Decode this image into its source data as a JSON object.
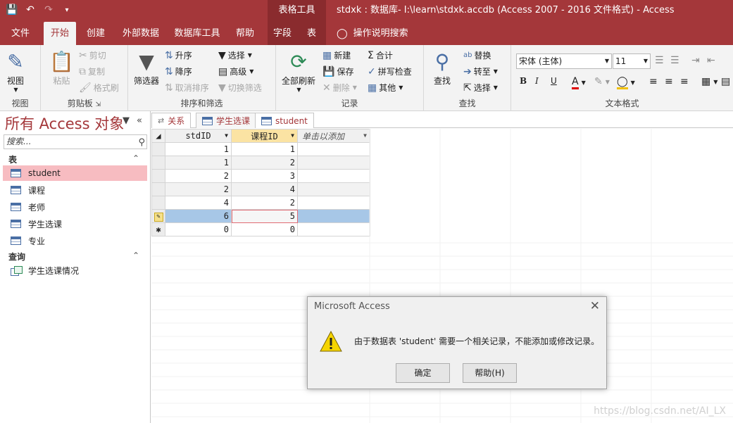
{
  "window": {
    "title": "stdxk : 数据库- I:\\learn\\stdxk.accdb (Access 2007 - 2016 文件格式)  -  Access",
    "context_band": "表格工具"
  },
  "tabs": [
    "文件",
    "开始",
    "创建",
    "外部数据",
    "数据库工具",
    "帮助",
    "字段",
    "表"
  ],
  "tell_me": "操作说明搜索",
  "ribbon": {
    "view": {
      "label": "视图",
      "group": "视图"
    },
    "clipboard": {
      "paste": "粘贴",
      "cut": "剪切",
      "copy": "复制",
      "format_painter": "格式刷",
      "group": "剪贴板"
    },
    "sort": {
      "filter": "筛选器",
      "asc": "升序",
      "desc": "降序",
      "remove_sort": "取消排序",
      "selection": "选择",
      "advanced": "高级",
      "toggle_filter": "切换筛选",
      "group": "排序和筛选"
    },
    "records": {
      "refresh_all": "全部刷新",
      "new": "新建",
      "save": "保存",
      "delete": "删除",
      "totals": "合计",
      "spelling": "拼写检查",
      "more": "其他",
      "group": "记录"
    },
    "find": {
      "find": "查找",
      "replace": "替换",
      "goto": "转至",
      "select": "选择",
      "group": "查找"
    },
    "text": {
      "font": "宋体 (主体)",
      "size": "11",
      "bold": "B",
      "italic": "I",
      "underline": "U",
      "group": "文本格式"
    }
  },
  "nav": {
    "title": "所有 Access 对象",
    "search_placeholder": "搜索...",
    "sections": [
      {
        "label": "表",
        "items": [
          "student",
          "课程",
          "老师",
          "学生选课",
          "专业"
        ]
      },
      {
        "label": "查询",
        "items": [
          "学生选课情况"
        ]
      }
    ],
    "selected": "student"
  },
  "doc_tabs": [
    "关系",
    "学生选课",
    "student"
  ],
  "grid": {
    "columns": [
      "stdID",
      "课程ID",
      "单击以添加"
    ],
    "rows": [
      [
        "1",
        "1"
      ],
      [
        "1",
        "2"
      ],
      [
        "2",
        "3"
      ],
      [
        "2",
        "4"
      ],
      [
        "4",
        "2"
      ],
      [
        "6",
        "5"
      ],
      [
        "0",
        "0"
      ]
    ],
    "current_row": 5
  },
  "dialog": {
    "title": "Microsoft Access",
    "message": "由于数据表 'student' 需要一个相关记录，不能添加或修改记录。",
    "ok": "确定",
    "help": "帮助(H)"
  },
  "watermark": "https://blog.csdn.net/AI_LX",
  "colors": {
    "accent": "#a4373a",
    "selection": "#f7bcc1",
    "row_highlight": "#a7c7e7"
  }
}
